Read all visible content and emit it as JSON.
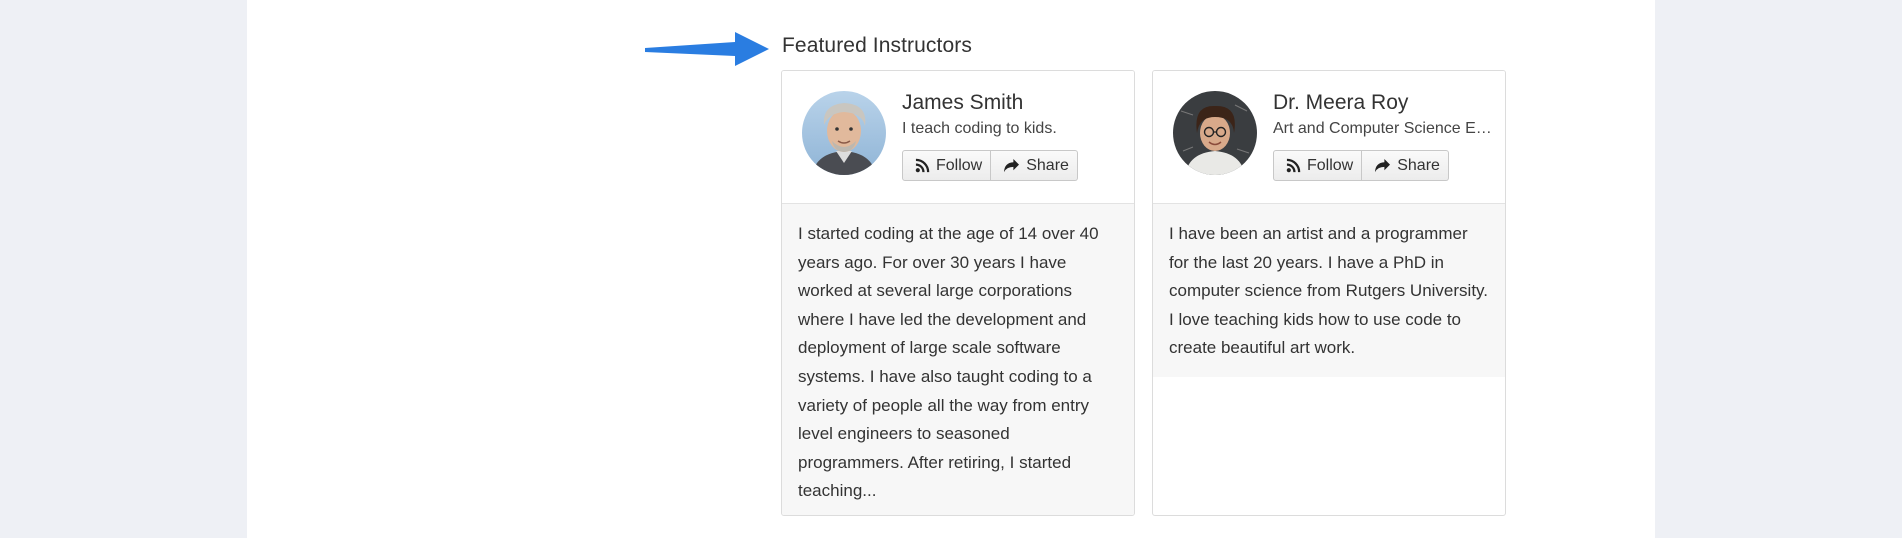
{
  "section": {
    "title": "Featured Instructors"
  },
  "instructors": [
    {
      "name": "James Smith",
      "tagline": "I teach coding to kids.",
      "follow_label": "Follow",
      "share_label": "Share",
      "bio": "I started coding at the age of 14 over 40 years ago. For over 30 years I have worked at several large corporations where I have led the development and deployment of large scale software systems. I have also taught coding to a variety of people all the way from entry level engineers to seasoned programmers.  After retiring, I started teaching..."
    },
    {
      "name": "Dr. Meera Roy",
      "tagline": "Art and Computer Science Educator",
      "follow_label": "Follow",
      "share_label": "Share",
      "bio": "I have been an artist and a programmer for the last 20 years. I have a PhD in computer science from Rutgers University. I love teaching kids how to use code to create beautiful art work."
    }
  ],
  "colors": {
    "arrow": "#2a7de1",
    "page_bg": "#eef0f5",
    "card_bio_bg": "#f7f7f7"
  },
  "icons": [
    "arrow-pointer-icon",
    "rss-icon",
    "share-icon",
    "avatar-photo"
  ]
}
